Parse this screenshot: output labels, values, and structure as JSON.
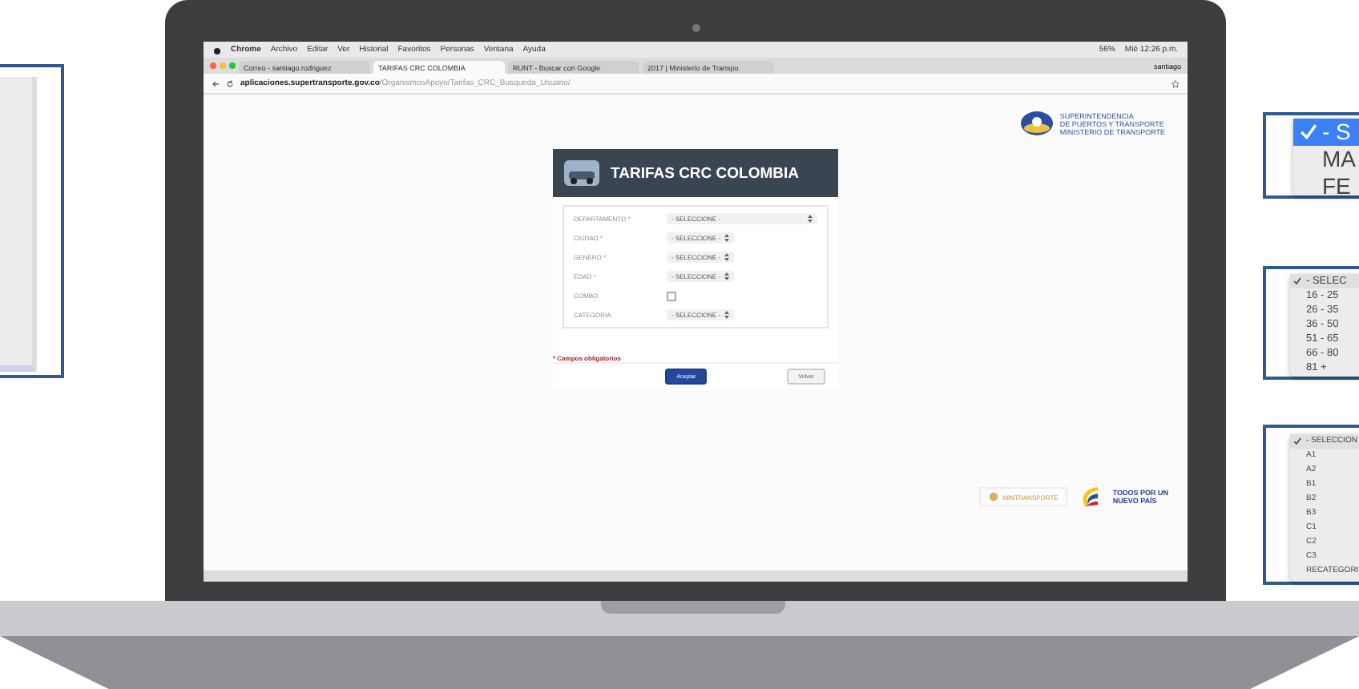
{
  "menubar": {
    "app": "Chrome",
    "menus": [
      "Archivo",
      "Editar",
      "Ver",
      "Historial",
      "Favoritos",
      "Personas",
      "Ventana",
      "Ayuda"
    ],
    "battery": "56%",
    "clock": "Mié 12:26 p.m."
  },
  "tabs": [
    {
      "label": "Correo - santiago.rodriguez",
      "selected": false
    },
    {
      "label": "TARIFAS CRC COLOMBIA",
      "selected": true
    },
    {
      "label": "RUNT - Buscar con Google",
      "selected": false
    },
    {
      "label": "2017 | Ministerio de Transpo",
      "selected": false
    }
  ],
  "profile": "santiago",
  "address": {
    "host": "aplicaciones.supertransporte.gov.co",
    "path": "/OrganismosApoyo/Tarifas_CRC_Busqueda_Usuario/"
  },
  "agency_logo": [
    "SUPERINTENDENCIA",
    "DE PUERTOS Y TRANSPORTE",
    "MINISTERIO DE TRANSPORTE"
  ],
  "form": {
    "title": "TARIFAS CRC COLOMBIA",
    "fields": [
      {
        "label": "DEPARTAMENTO *",
        "kind": "select",
        "wide": true,
        "value": "- SELECCIONE -"
      },
      {
        "label": "CIUDAD *",
        "kind": "select",
        "wide": false,
        "value": "- SELECCIONE -"
      },
      {
        "label": "GENERO *",
        "kind": "select",
        "wide": false,
        "value": "- SELECCIONE -"
      },
      {
        "label": "EDAD *",
        "kind": "select",
        "wide": false,
        "value": "- SELECCIONE -"
      },
      {
        "label": "COMBO",
        "kind": "checkbox",
        "checked": false
      },
      {
        "label": "CATEGORIA",
        "kind": "select",
        "wide": false,
        "value": "- SELECCIONE -"
      }
    ],
    "required_note": "* Campos obligatorios",
    "buttons": [
      "Aceptar",
      "Volver"
    ]
  },
  "footer": {
    "ministry": "MINTRANSPORTE",
    "slogan": [
      "TODOS POR UN",
      "NUEVO PAÍS"
    ]
  },
  "callouts": [
    {
      "kind": "large",
      "options": [
        {
          "label": "- S",
          "selected": true
        },
        {
          "label": "MA",
          "selected": false
        },
        {
          "label": "FE",
          "selected": false
        }
      ]
    },
    {
      "kind": "medium",
      "options": [
        {
          "label": "- SELEC",
          "selected": true
        },
        {
          "label": "16 - 25",
          "selected": false
        },
        {
          "label": "26 - 35",
          "selected": false
        },
        {
          "label": "36 - 50",
          "selected": false
        },
        {
          "label": "51 - 65",
          "selected": false
        },
        {
          "label": "66 - 80",
          "selected": false
        },
        {
          "label": "81 +",
          "selected": false
        }
      ]
    },
    {
      "kind": "small",
      "options": [
        {
          "label": "- SELECCION",
          "selected": true
        },
        {
          "label": "A1",
          "selected": false
        },
        {
          "label": "A2",
          "selected": false
        },
        {
          "label": "B1",
          "selected": false
        },
        {
          "label": "B2",
          "selected": false
        },
        {
          "label": "B3",
          "selected": false
        },
        {
          "label": "C1",
          "selected": false
        },
        {
          "label": "C2",
          "selected": false
        },
        {
          "label": "C3",
          "selected": false
        },
        {
          "label": "RECATEGORI",
          "selected": false
        }
      ]
    }
  ]
}
